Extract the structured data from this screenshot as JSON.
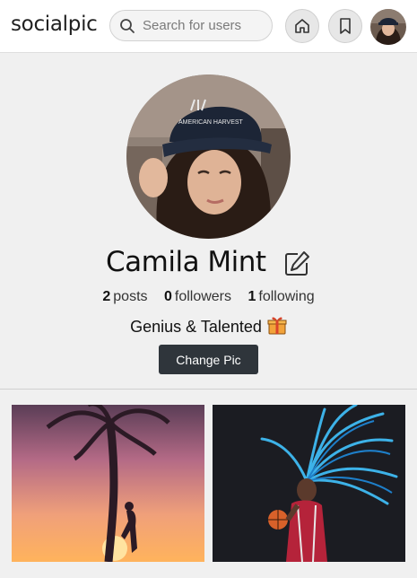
{
  "header": {
    "logo": "socialpic",
    "search_placeholder": "Search for users",
    "icons": {
      "search": "search-icon",
      "home": "home-icon",
      "bookmark": "bookmark-icon"
    }
  },
  "profile": {
    "name": "Camila Mint",
    "stats": {
      "posts_count": "2",
      "posts_label": "posts",
      "followers_count": "0",
      "followers_label": "followers",
      "following_count": "1",
      "following_label": "following"
    },
    "bio": "Genius & Talented",
    "bio_emoji": "gift-icon",
    "change_pic_label": "Change Pic",
    "cap_text": "AMERICAN HARVEST"
  },
  "posts": [
    {
      "description": "palm-tree-sunset"
    },
    {
      "description": "blue-hair-basketball"
    }
  ],
  "colors": {
    "accent_button": "#2f353b",
    "background": "#f0f0f0"
  }
}
